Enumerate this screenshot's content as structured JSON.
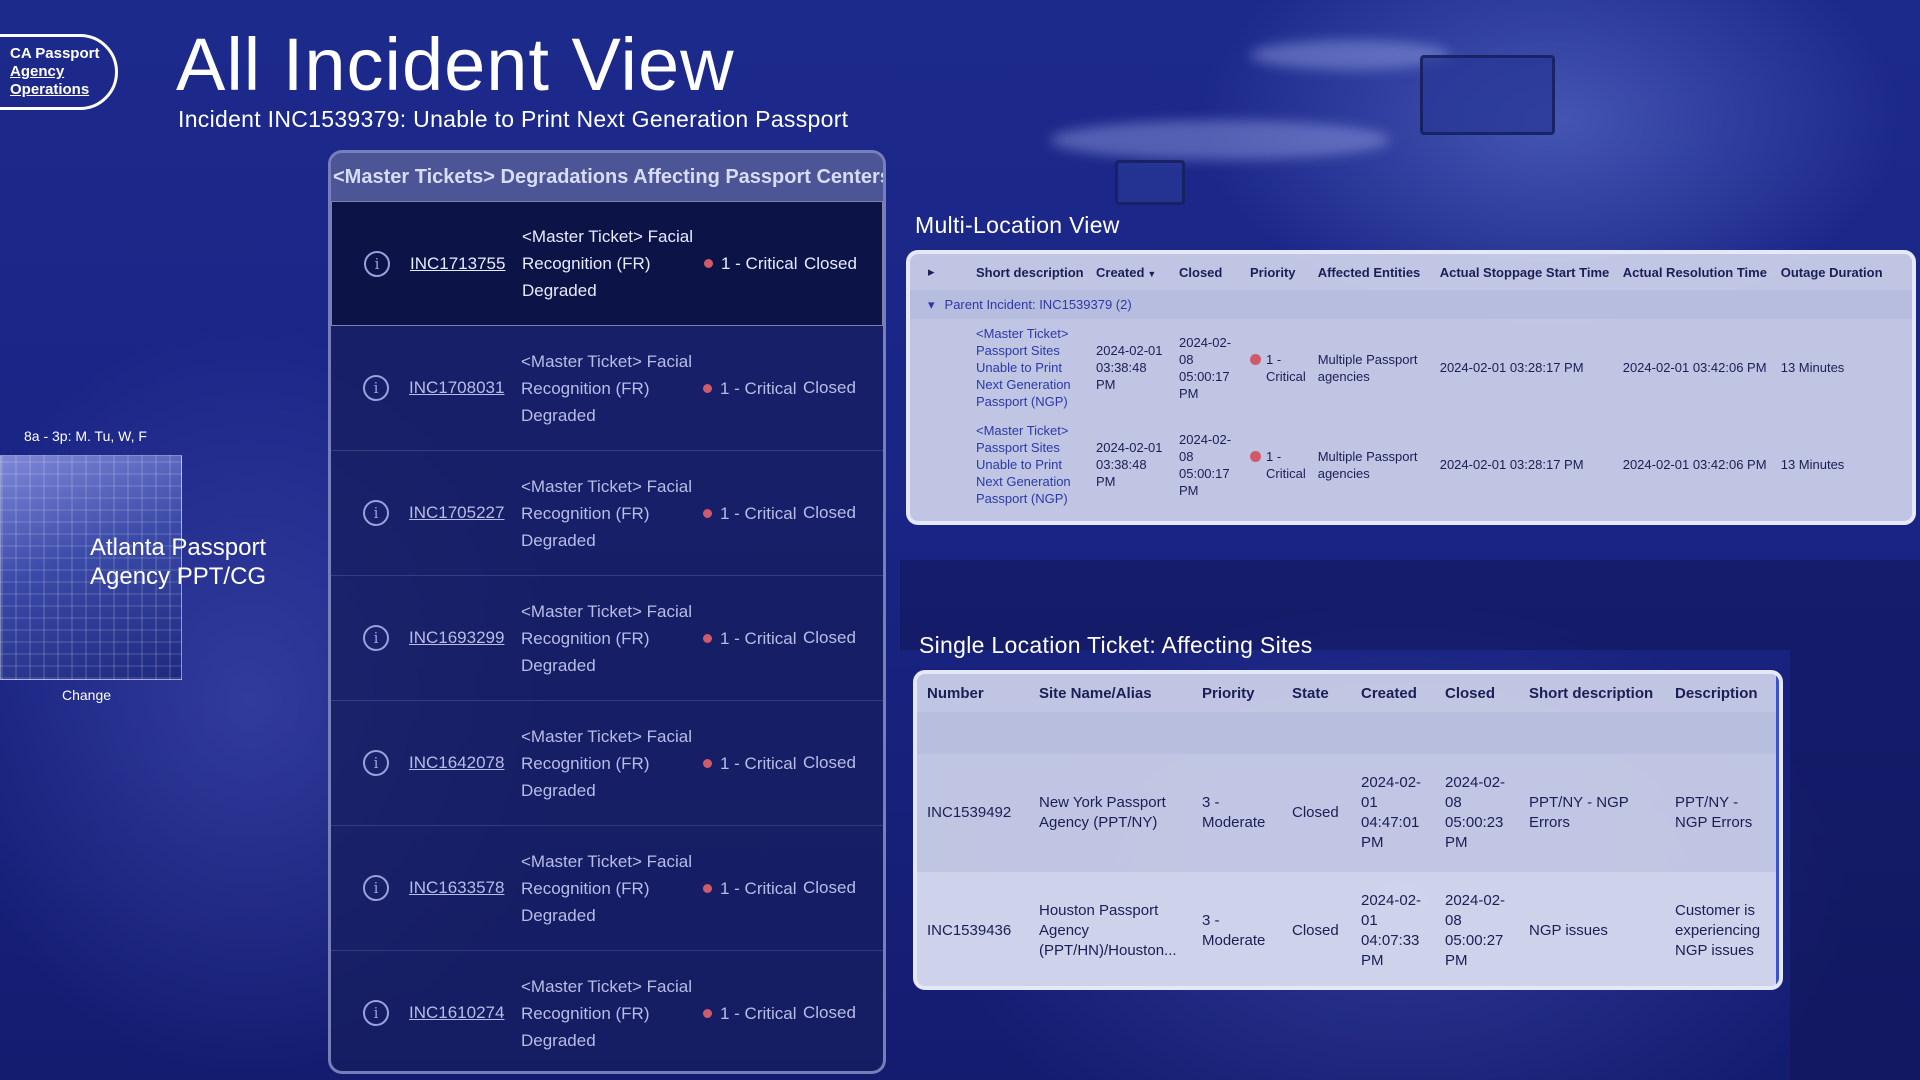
{
  "logo": {
    "line1": "CA Passport",
    "line2": "Agency",
    "line3": "Operations"
  },
  "page": {
    "title": "All Incident View",
    "subtitle": "Incident INC1539379: Unable to Print Next Generation Passport"
  },
  "location": {
    "hours": "8a - 3p: M. Tu, W, F",
    "name": "Atlanta Passport Agency PPT/CG",
    "change_label": "Change"
  },
  "master": {
    "header": "<Master Tickets> Degradations Affecting Passport Centers",
    "rows": [
      {
        "number": "INC1713755",
        "desc": "<Master Ticket> Facial Recognition (FR) Degraded",
        "priority": "1 - Critical",
        "state": "Closed"
      },
      {
        "number": "INC1708031",
        "desc": "<Master Ticket> Facial Recognition (FR) Degraded",
        "priority": "1 - Critical",
        "state": "Closed"
      },
      {
        "number": "INC1705227",
        "desc": "<Master Ticket> Facial Recognition (FR) Degraded",
        "priority": "1 - Critical",
        "state": "Closed"
      },
      {
        "number": "INC1693299",
        "desc": "<Master Ticket> Facial Recognition (FR) Degraded",
        "priority": "1 - Critical",
        "state": "Closed"
      },
      {
        "number": "INC1642078",
        "desc": "<Master Ticket> Facial Recognition (FR) Degraded",
        "priority": "1 - Critical",
        "state": "Closed"
      },
      {
        "number": "INC1633578",
        "desc": "<Master Ticket> Facial Recognition (FR) Degraded",
        "priority": "1 - Critical",
        "state": "Closed"
      },
      {
        "number": "INC1610274",
        "desc": "<Master Ticket> Facial Recognition (FR) Degraded",
        "priority": "1 - Critical",
        "state": "Closed"
      }
    ]
  },
  "multi": {
    "title": "Multi-Location View",
    "columns": [
      "Short description",
      "Created",
      "Closed",
      "Priority",
      "Affected Entities",
      "Actual Stoppage Start Time",
      "Actual Resolution Time",
      "Outage Duration"
    ],
    "group_label": "Parent Incident: INC1539379 (2)",
    "rows": [
      {
        "short_desc": "<Master Ticket> Passport Sites Unable to Print Next Generation Passport (NGP)",
        "created": "2024-02-01 03:38:48 PM",
        "closed": "2024-02-08 05:00:17 PM",
        "priority": "1 - Critical",
        "entities": "Multiple Passport agencies",
        "stoppage": "2024-02-01 03:28:17 PM",
        "resolution": "2024-02-01 03:42:06 PM",
        "duration": "13 Minutes"
      },
      {
        "short_desc": "<Master Ticket> Passport Sites Unable to Print Next Generation Passport (NGP)",
        "created": "2024-02-01 03:38:48 PM",
        "closed": "2024-02-08 05:00:17 PM",
        "priority": "1 - Critical",
        "entities": "Multiple Passport agencies",
        "stoppage": "2024-02-01 03:28:17 PM",
        "resolution": "2024-02-01 03:42:06 PM",
        "duration": "13 Minutes"
      }
    ]
  },
  "single": {
    "title": "Single Location Ticket: Affecting Sites",
    "columns": [
      "Number",
      "Site Name/Alias",
      "Priority",
      "State",
      "Created",
      "Closed",
      "Short description",
      "Description"
    ],
    "rows": [
      {
        "number": "INC1539492",
        "site": "New York Passport Agency (PPT/NY)",
        "priority": "3 - Moderate",
        "state": "Closed",
        "created": "2024-02-01 04:47:01 PM",
        "closed": "2024-02-08 05:00:23 PM",
        "short_desc": "PPT/NY - NGP Errors",
        "description": "PPT/NY - NGP Errors"
      },
      {
        "number": "INC1539436",
        "site": "Houston Passport Agency (PPT/HN)/Houston...",
        "priority": "3 - Moderate",
        "state": "Closed",
        "created": "2024-02-01 04:07:33 PM",
        "closed": "2024-02-08 05:00:27 PM",
        "short_desc": "NGP issues",
        "description": "Customer is experiencing NGP issues"
      }
    ]
  },
  "icons": {
    "info": "info-icon",
    "expand": "caret-right-icon",
    "collapse": "caret-down-icon",
    "sort": "sort-down-icon"
  },
  "colors": {
    "background": "#1a2585",
    "critical": "#d05a6a",
    "link": "#2b3aa8",
    "accent_border": "#3a52d0"
  }
}
